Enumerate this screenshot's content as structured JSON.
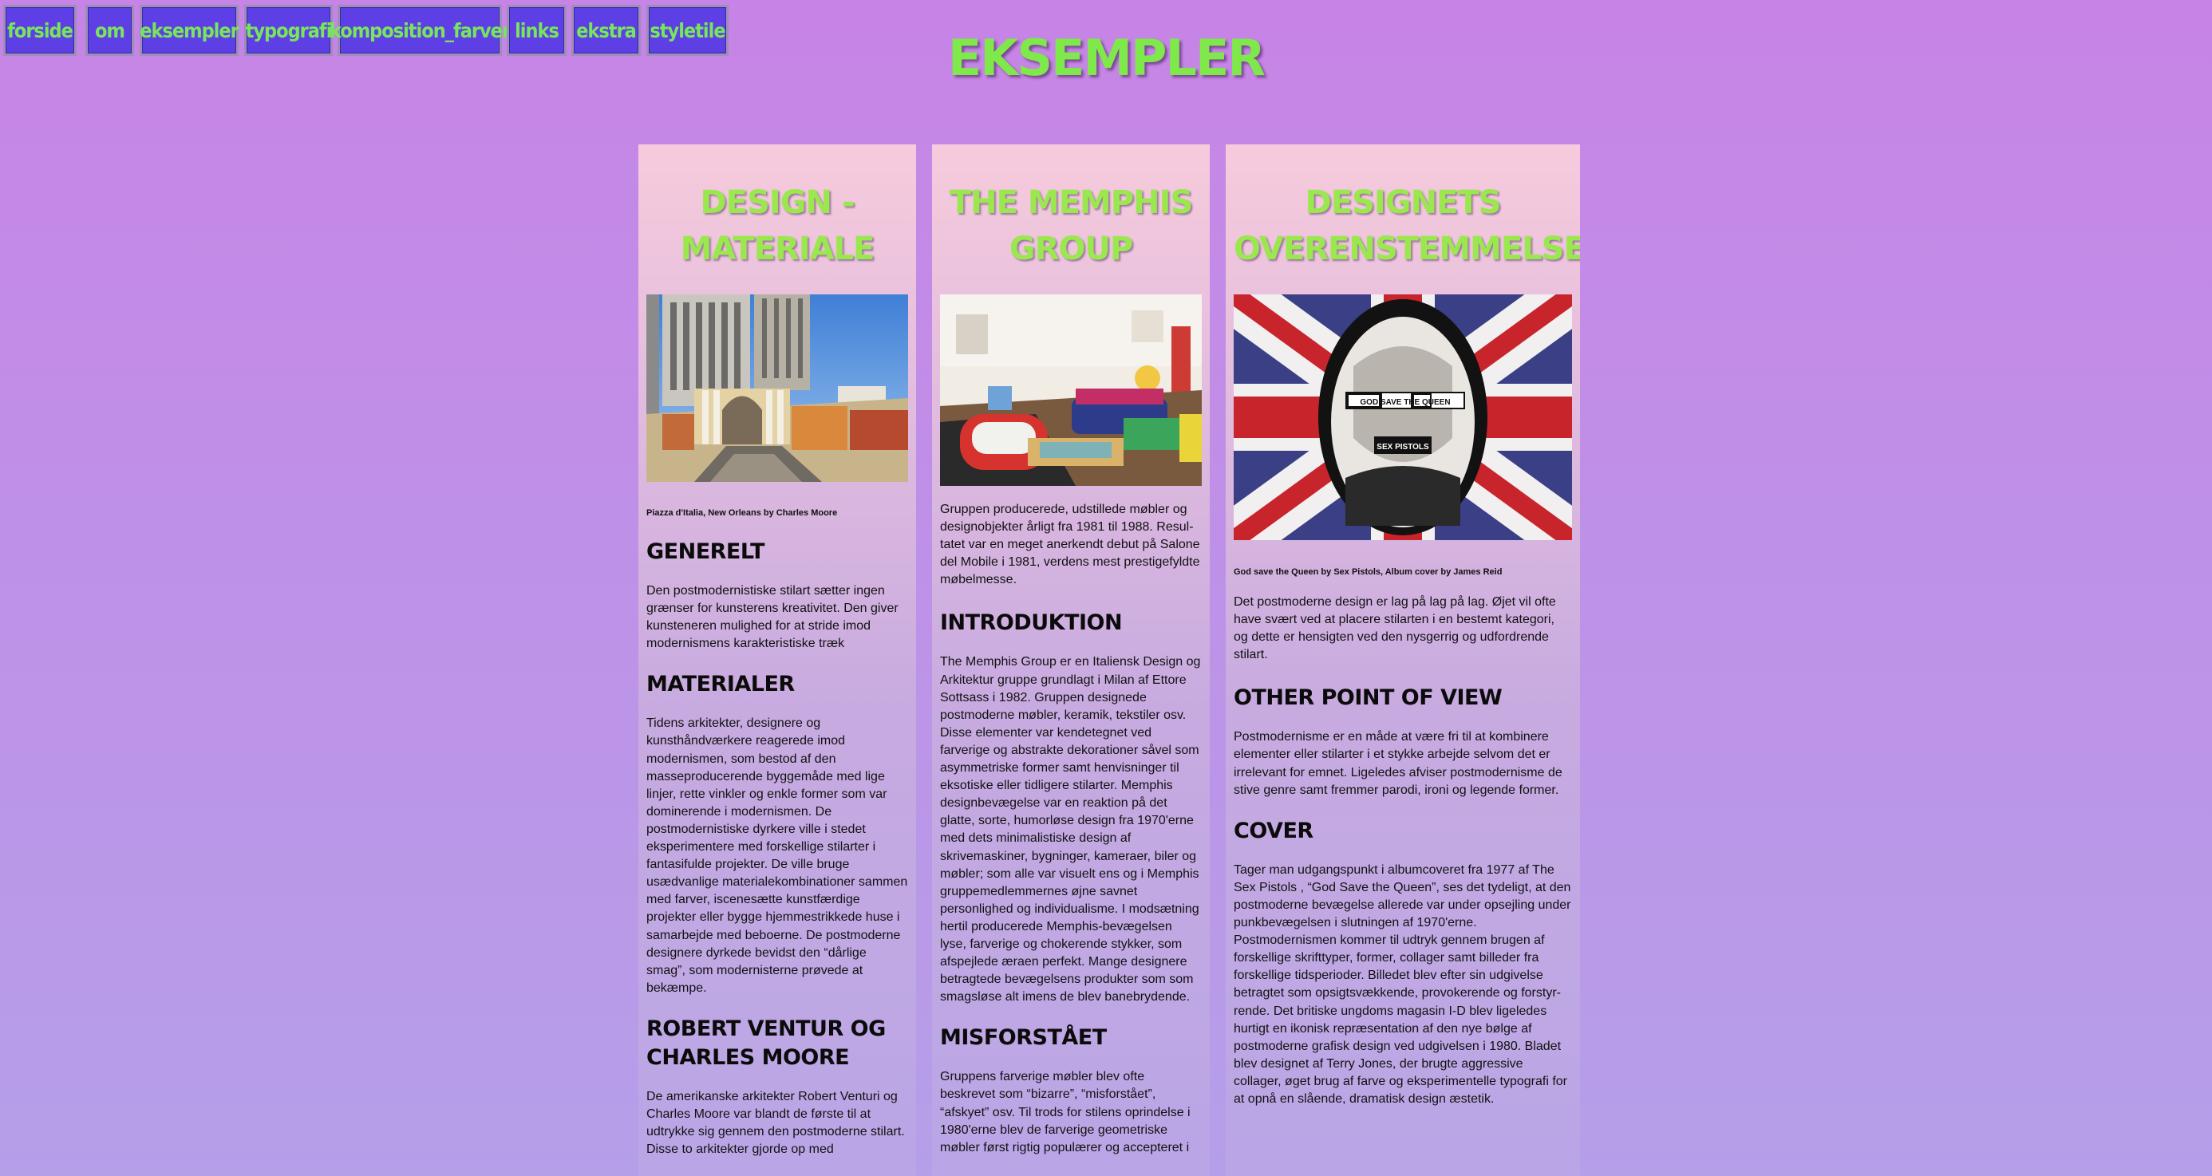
{
  "nav": {
    "items": [
      {
        "label": "forside"
      },
      {
        "label": "om"
      },
      {
        "label": "eksempler"
      },
      {
        "label": "typografi"
      },
      {
        "label": "komposition_farver"
      },
      {
        "label": "links"
      },
      {
        "label": "ekstra"
      },
      {
        "label": "styletile"
      }
    ]
  },
  "page": {
    "title": "EKSEMPLER"
  },
  "columns": [
    {
      "title": "DESIGN - MATERIALE",
      "image_alt": "Piazza d'Italia photograph",
      "caption": "Piazza d'Italia, New Orleans by Charles Moore",
      "sections": [
        {
          "heading": "GENERELT",
          "text": "Den postmodernistiske stilart sætter ingen grænser for kunsterens kreativitet. Den giver kunsteneren mulighed for at stride imod modernismens karakteristiske træk"
        },
        {
          "heading": "MATERIALER",
          "text": "Tidens arkitekter, designere og kunsthåndværkere reagerede imod modernismen, som bestod af den masseproducerende byggemåde med lige linjer, rette vinkler og enkle former som var dominerende i modernismen. De postmodernistiske dyrkere ville i stedet eksperimentere med forskellige stilarter i fantasifulde projekter. De ville bruge usædvanlige materialekombinationer sammen med farver, iscenesætte kunstfærdige projekter eller bygge hjemmestrikkede huse i samarbejde med beboerne. De postmoderne designere dyrkede bevidst den “dårlige smag”, som modernisterne prøvede at bekæmpe."
        },
        {
          "heading": "ROBERT VENTUR OG CHARLES MOORE",
          "text": "De amerikanske arkitekter Robert Venturi og Charles Moore var blandt de første til at udtrykke sig gennem den postmoderne stilart. Disse to arkitekter gjorde op med"
        }
      ]
    },
    {
      "title": "THE MEMPHIS GROUP",
      "image_alt": "Memphis Group interior photograph",
      "caption": "",
      "intro": "Gruppen producerede, udstillede møbler og designobjekter årligt fra 1981 til 1988. Resul-tatet var en meget anerkendt debut på Salone del Mobile i 1981, verdens mest prestigefyldte møbelmesse.",
      "sections": [
        {
          "heading": "INTRODUKTION",
          "text": "The Memphis Group er en Italiensk Design og Arkitektur gruppe grundlagt i Milan af Ettore Sottsass i 1982. Gruppen designede postmoderne møbler, keramik, tekstiler osv. Disse elementer var kendetegnet ved farverige og abstrakte dekorationer såvel som asymmetriske former samt henvisninger til eksotiske eller tidligere stilarter. Memphis designbevægelse var en reaktion på det glatte, sorte, humorløse design fra 1970'erne med dets minimalistiske design af skrivemaskiner, bygninger, kameraer, biler og møbler; som alle var visuelt ens og i Memphis gruppemedlemmernes øjne savnet personlighed og individualisme. I modsætning hertil producerede Memphis-bevægelsen lyse, farverige og chokerende stykker, som afspejlede æraen perfekt. Mange designere betragtede bevægelsens produkter som som smagsløse alt imens de blev banebrydende."
        },
        {
          "heading": "MISFORSTÅET",
          "text": "Gruppens farverige møbler blev ofte beskrevet som “bizarre”, “misforstået”, “afskyet” osv. Til trods for stilens oprindelse i 1980'erne blev de farverige geometriske møbler først rigtig populærer og accepteret i"
        }
      ]
    },
    {
      "title": "DESIGNETS OVERENSTEMMELSE",
      "image_alt": "God Save the Queen album cover",
      "caption": "God save the Queen by Sex Pistols, Album cover by James Reid",
      "cover_text": {
        "line1": "GOD SAVE THE QUEEN",
        "line2": "SEX PISTOLS"
      },
      "intro": "Det postmoderne design er lag på lag på lag. Øjet vil ofte have svært ved at placere stilarten i en bestemt kategori, og dette er hensigten ved den nysgerrig og udfordrende stilart.",
      "sections": [
        {
          "heading": "OTHER POINT OF VIEW",
          "text": "Postmodernisme er en måde at være fri til at kombinere elementer eller stilarter i et stykke arbejde selvom det er irrelevant for emnet. Ligeledes afviser postmodernisme de stive genre samt fremmer parodi, ironi og legende former."
        },
        {
          "heading": "COVER",
          "text": "Tager man udgangspunkt i albumcoveret fra 1977 af The Sex Pistols , “God Save the Queen”, ses det tydeligt, at den postmoderne bevægelse allerede var under opsejling under punkbevægelsen i slutningen af 1970'erne. Postmodernismen kommer til udtryk gennem brugen af forskellige skrifttyper, former, collager samt billeder fra forskellige tidsperioder. Billedet blev efter sin udgivelse betragtet som opsigtsvækkende, provokerende og forstyr-rende. Det britiske ungdoms magasin I-D blev ligeledes hurtigt en ikonisk repræsentation af den nye bølge af postmoderne grafisk design ved udgivelsen i 1980. Bladet blev designet af Terry Jones, der brugte aggressive collager, øget brug af farve og eksperimentelle typografi for at opnå en slående, dramatisk design æstetik."
        }
      ]
    }
  ],
  "colors": {
    "background_top": "#c784e6",
    "background_bottom": "#b59fe9",
    "nav_button": "#5e3fe6",
    "accent_green": "#7fe84a",
    "column_top": "#f7cbdc"
  }
}
